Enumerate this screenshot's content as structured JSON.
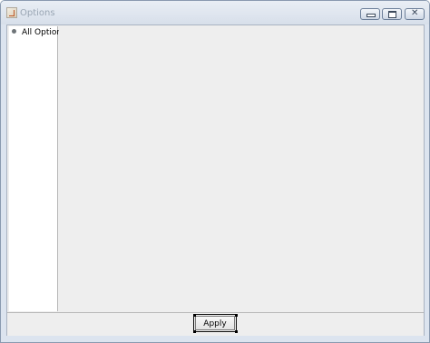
{
  "window": {
    "title": "Options",
    "app_icon": "java-cup-icon",
    "controls": {
      "minimize_icon": "minimize-icon",
      "maximize_icon": "maximize-icon",
      "close_icon": "close-icon",
      "close_glyph": "✕"
    }
  },
  "tree": {
    "items": [
      {
        "label": "All Options",
        "icon": "bullet-icon"
      }
    ]
  },
  "footer": {
    "apply_label": "Apply"
  },
  "colors": {
    "title_text": "#9aa6b4",
    "panel_background": "#eeeeee",
    "tree_background": "#ffffff",
    "frame_background": "#dce4ef"
  }
}
